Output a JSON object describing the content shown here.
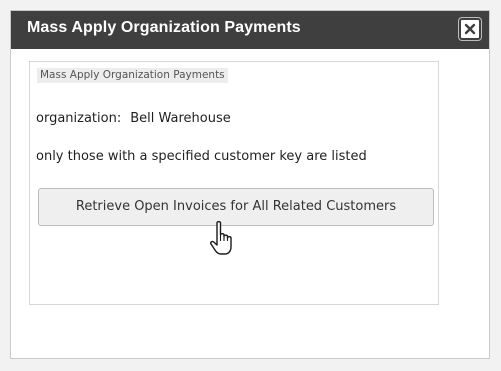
{
  "dialog": {
    "title": "Mass Apply Organization Payments",
    "close_icon": "close-icon"
  },
  "panel": {
    "legend": "Mass Apply Organization Payments",
    "organization_label": "organization:",
    "organization_value": "Bell Warehouse",
    "note": "only those with a specified customer key are listed",
    "retrieve_button_label": "Retrieve Open Invoices for All Related Customers"
  },
  "pointer": {
    "icon": "hand-pointer-icon"
  },
  "colors": {
    "titlebar": "#3f3f3f",
    "title_text": "#ffffff",
    "button_bg": "#efefef",
    "legend_bg": "#ededed"
  }
}
